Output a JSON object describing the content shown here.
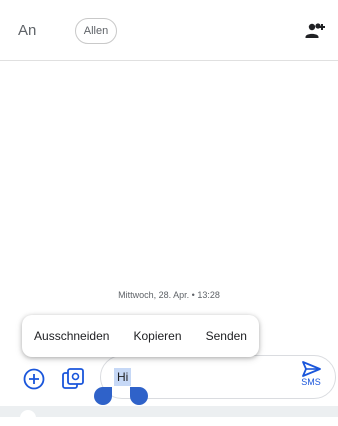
{
  "header": {
    "to_label": "An",
    "all_chip": "Allen",
    "add_contact_icon": "add-contact-icon"
  },
  "conversation": {
    "timestamp": "Mittwoch, 28. Apr. • 13:28"
  },
  "context_menu": {
    "items": [
      "Ausschneiden",
      "Kopieren",
      "Senden"
    ]
  },
  "composer": {
    "input_value": "Hi",
    "send_label": "SMS",
    "attach_icon": "plus-circle-icon",
    "gallery_icon": "gallery-icon",
    "send_icon": "send-icon"
  },
  "colors": {
    "accent": "#1a56db",
    "selection": "#c6d8f6",
    "handle": "#2f62c9"
  }
}
